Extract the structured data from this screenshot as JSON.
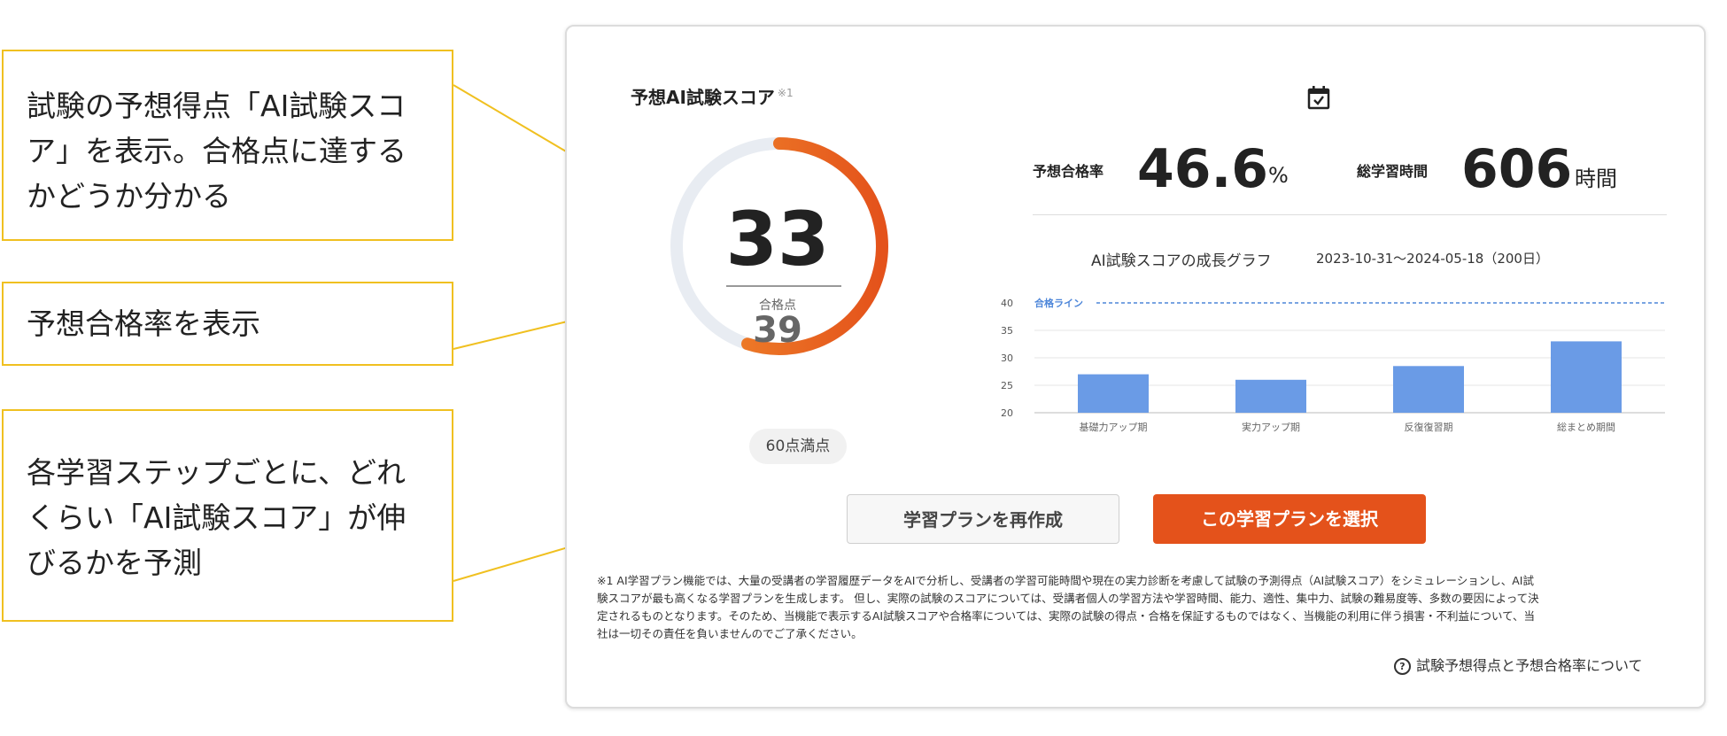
{
  "callouts": {
    "c1": [
      "試験の予想得点「AI試験スコ",
      "ア」を表示。合格点に達する",
      "かどうか分かる"
    ],
    "c2": [
      "予想合格率を表示"
    ],
    "c3": [
      "各学習ステップごとに、どれ",
      "くらい「AI試験スコア」が伸",
      "びるかを予測"
    ]
  },
  "score": {
    "title": "予想AI試験スコア",
    "note": "※1",
    "value": "33",
    "pass_label": "合格点",
    "pass_value": "39",
    "max_label": "60点満点",
    "progress": 0.55
  },
  "stats": {
    "rate_label": "予想合格率",
    "rate_value": "46.6",
    "rate_unit": "%",
    "hours_label": "総学習時間",
    "hours_value": "606",
    "hours_unit": "時間"
  },
  "chart_title": "AI試験スコアの成長グラフ",
  "chart_range": "2023-10-31〜2024-05-18（200日）",
  "chart_data": {
    "type": "bar",
    "categories": [
      "基礎力アップ期",
      "実力アップ期",
      "反復復習期",
      "総まとめ期間"
    ],
    "values": [
      27,
      26,
      28.5,
      33
    ],
    "ylim": [
      20,
      40
    ],
    "yticks": [
      20,
      25,
      30,
      35,
      40
    ],
    "threshold": {
      "label": "合格ライン",
      "value": 40
    },
    "bar_color": "#6a9be6",
    "line_color": "#4d86d9"
  },
  "buttons": {
    "remake": "学習プランを再作成",
    "select": "この学習プランを選択"
  },
  "disclaimer": [
    "※1 AI学習プラン機能では、大量の受講者の学習履歴データをAIで分析し、受講者の学習可能時間や現在の実力診断を考慮して試験の予測得点（AI試験スコア）をシミュレーションし、AI試",
    "験スコアが最も高くなる学習プランを生成します。 但し、実際の試験のスコアについては、受講者個人の学習方法や学習時間、能力、適性、集中力、試験の難易度等、多数の要因によって決",
    "定されるものとなります。そのため、当機能で表示するAI試験スコアや合格率については、実際の試験の得点・合格を保証するものではなく、当機能の利用に伴う損害・不利益について、当",
    "社は一切その責任を負いませんのでご了承ください。"
  ],
  "help_link": "試験予想得点と予想合格率について",
  "colors": {
    "accent": "#e4521b",
    "callout_border": "#f0c020",
    "gauge_track": "#e8ecf2"
  }
}
